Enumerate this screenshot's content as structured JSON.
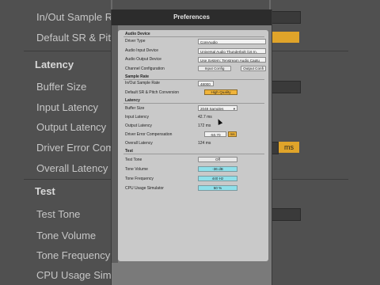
{
  "background": {
    "left_labels": [
      {
        "text": "In/Out Sample R",
        "bold": false
      },
      {
        "text": "Default SR & Pit",
        "bold": false
      },
      {
        "text": "Latency",
        "bold": true
      },
      {
        "text": "Buffer Size",
        "bold": false
      },
      {
        "text": "Input Latency",
        "bold": false
      },
      {
        "text": "Output Latency",
        "bold": false
      },
      {
        "text": "Driver Error Com",
        "bold": false
      },
      {
        "text": "Overall Latency",
        "bold": false
      },
      {
        "text": "Test",
        "bold": true
      },
      {
        "text": "Test Tone",
        "bold": false
      },
      {
        "text": "Tone Volume",
        "bold": false
      },
      {
        "text": "Tone Frequency",
        "bold": false
      },
      {
        "text": "CPU Usage Simu",
        "bold": false
      }
    ],
    "right_fragment": "ms"
  },
  "dialog": {
    "title": "Preferences",
    "sections": {
      "audio_device": "Audio Device",
      "sample_rate": "Sample Rate",
      "latency": "Latency",
      "test": "Test"
    },
    "driver_type": {
      "label": "Driver Type",
      "value": "CoreAudio"
    },
    "audio_input_device": {
      "label": "Audio Input Device",
      "value": "Universal Audio Thunderbolt (16 In,"
    },
    "audio_output_device": {
      "label": "Audio Output Device",
      "value": "Use System: Tenstream Audio Captu"
    },
    "channel_configuration": {
      "label": "Channel Configuration",
      "input_button": "Input Config",
      "output_button": "Output Confi"
    },
    "in_out_sample_rate": {
      "label": "In/Out Sample Rate",
      "value": "48000"
    },
    "default_sr_pitch": {
      "label": "Default SR & Pitch Conversion",
      "value": "High Quality"
    },
    "buffer_size": {
      "label": "Buffer Size",
      "value": "2048 Samples"
    },
    "input_latency": {
      "label": "Input Latency",
      "value": "42.7 ms"
    },
    "output_latency": {
      "label": "Output Latency",
      "value": "172 ms"
    },
    "driver_error_comp": {
      "label": "Driver Error Compensation",
      "value": "-50.70",
      "unit": "ms"
    },
    "overall_latency": {
      "label": "Overall Latency",
      "value": "124 ms"
    },
    "test_tone": {
      "label": "Test Tone",
      "value": "Off"
    },
    "tone_volume": {
      "label": "Tone Volume",
      "value": "-36 dB"
    },
    "tone_frequency": {
      "label": "Tone Frequency",
      "value": "440 Hz"
    },
    "cpu_usage_simulator": {
      "label": "CPU Usage Simulator",
      "value": "50 %"
    }
  },
  "colors": {
    "accent_yellow": "#f0b43a",
    "accent_cyan": "#8fe0ea",
    "titlebar": "#2c2c2c"
  }
}
